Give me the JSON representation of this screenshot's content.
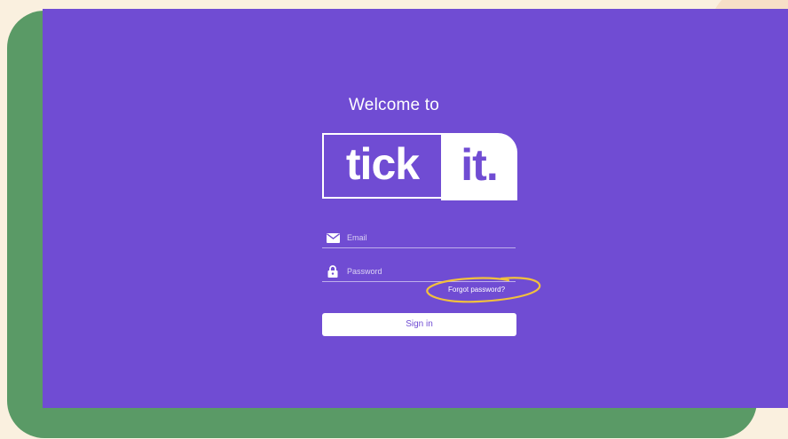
{
  "screen": {
    "welcome_text": "Welcome to",
    "logo": {
      "part1": "tick",
      "part2": "it."
    }
  },
  "form": {
    "email": {
      "placeholder": "Email",
      "value": "",
      "icon": "envelope-icon"
    },
    "password": {
      "placeholder": "Password",
      "value": "",
      "icon": "lock-icon"
    },
    "forgot_label": "Forgot password?",
    "signin_label": "Sign in"
  },
  "colors": {
    "brand_purple": "#704CD3",
    "card_green": "#5A9A66",
    "background_cream": "#FAF0DF",
    "highlight_yellow": "#F2C13D",
    "text_white": "#FFFFFF"
  }
}
